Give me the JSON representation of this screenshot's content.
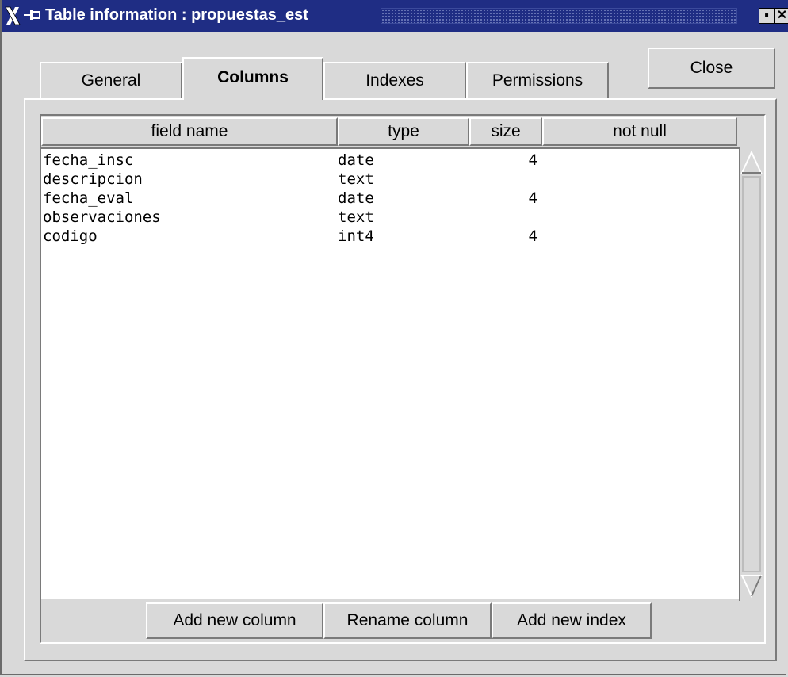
{
  "window": {
    "title": "Table information : propuestas_est",
    "minimize_glyph": "▪",
    "close_glyph": "✕"
  },
  "tabs": [
    {
      "label": "General",
      "active": false
    },
    {
      "label": "Columns",
      "active": true
    },
    {
      "label": "Indexes",
      "active": false
    },
    {
      "label": "Permissions",
      "active": false
    }
  ],
  "close_label": "Close",
  "columns_table": {
    "headers": [
      "field name",
      "type",
      "size",
      "not null"
    ],
    "rows": [
      {
        "field_name": "fecha_insc",
        "type": "date",
        "size": "4",
        "not_null": ""
      },
      {
        "field_name": "descripcion",
        "type": "text",
        "size": "",
        "not_null": ""
      },
      {
        "field_name": "fecha_eval",
        "type": "date",
        "size": "4",
        "not_null": ""
      },
      {
        "field_name": "observaciones",
        "type": "text",
        "size": "",
        "not_null": ""
      },
      {
        "field_name": "codigo",
        "type": "int4",
        "size": "4",
        "not_null": ""
      }
    ]
  },
  "buttons": {
    "add_column": "Add new column",
    "rename_column": "Rename column",
    "add_index": "Add new index"
  },
  "icons": {
    "app": "x-logo-icon",
    "pin": "pin-icon",
    "scroll_up": "triangle-up-icon",
    "scroll_down": "triangle-down-icon"
  },
  "colors": {
    "titlebar": "#1f2d84",
    "window_bg": "#d9d9d9",
    "list_bg": "#ffffff"
  }
}
